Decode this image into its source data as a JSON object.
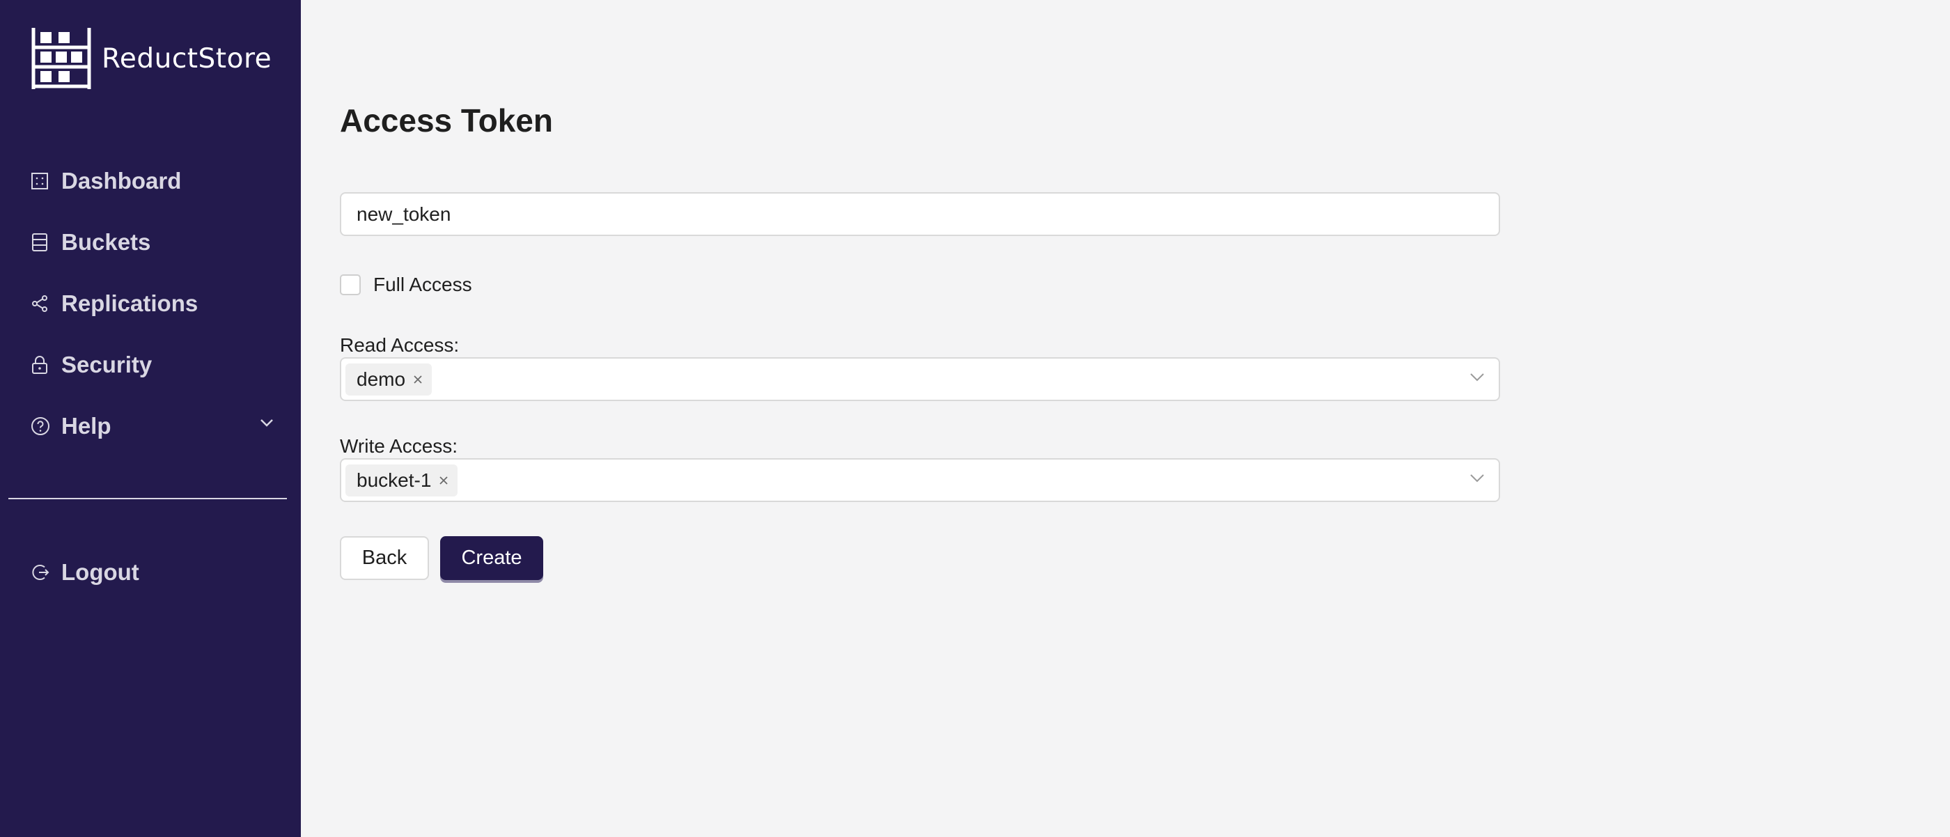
{
  "app": {
    "name": "ReductStore",
    "logo_icon": "shelf-logo-icon"
  },
  "sidebar": {
    "items": [
      {
        "label": "Dashboard",
        "icon": "dashboard-icon"
      },
      {
        "label": "Buckets",
        "icon": "database-icon"
      },
      {
        "label": "Replications",
        "icon": "share-icon"
      },
      {
        "label": "Security",
        "icon": "lock-icon"
      },
      {
        "label": "Help",
        "icon": "question-circle-icon",
        "expand_icon": "chevron-down-icon"
      },
      {
        "label": "Logout",
        "icon": "logout-icon"
      }
    ]
  },
  "main": {
    "title": "Access Token",
    "token_name": {
      "value": "new_token"
    },
    "full_access": {
      "label": "Full Access",
      "checked": false
    },
    "read_access": {
      "label": "Read Access:",
      "tags": [
        "demo"
      ]
    },
    "write_access": {
      "label": "Write Access:",
      "tags": [
        "bucket-1"
      ]
    },
    "buttons": {
      "back": "Back",
      "create": "Create"
    }
  },
  "colors": {
    "sidebar_bg": "#231a4d",
    "page_bg": "#f4f4f5",
    "primary": "#231a4d"
  }
}
